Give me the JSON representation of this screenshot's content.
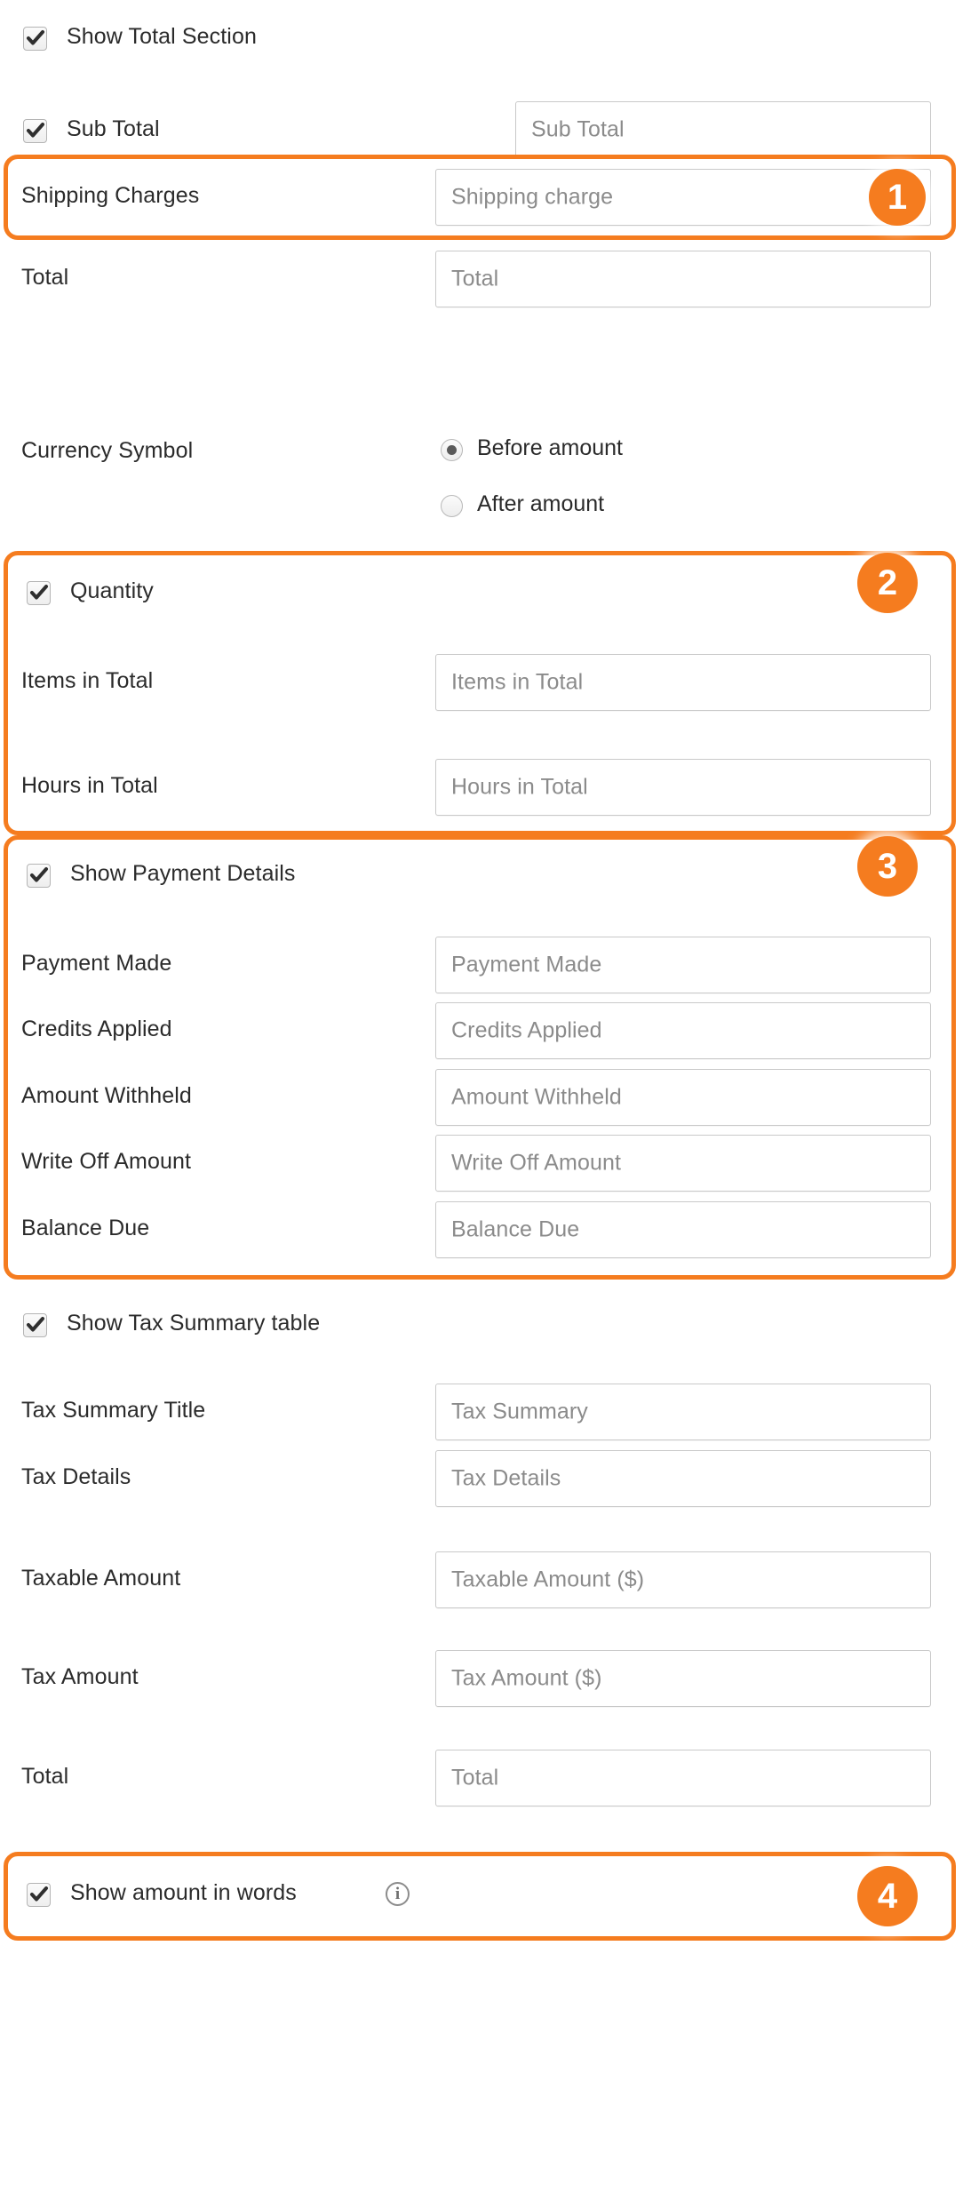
{
  "colors": {
    "accent": "#F57C1F",
    "label_text": "#2b2b2b",
    "placeholder_text": "#8b8b8b",
    "field_border": "#c9c9c9",
    "page_background": "#ffffff"
  },
  "sections": {
    "total_section": {
      "toggle_label": "Show Total Section",
      "toggle_checked": true
    },
    "sub_total": {
      "toggle_label": "Sub Total",
      "toggle_checked": true,
      "field_placeholder": "Sub Total"
    },
    "shipping_charges": {
      "label": "Shipping Charges",
      "field_placeholder": "Shipping charge"
    },
    "total": {
      "label": "Total",
      "field_placeholder": "Total"
    },
    "currency_symbol": {
      "label": "Currency Symbol",
      "options": [
        {
          "label": "Before amount",
          "selected": true
        },
        {
          "label": "After amount",
          "selected": false
        }
      ]
    },
    "quantity": {
      "toggle_label": "Quantity",
      "toggle_checked": true,
      "rows": [
        {
          "label": "Items in Total",
          "placeholder": "Items in Total"
        },
        {
          "label": "Hours in Total",
          "placeholder": "Hours in Total"
        }
      ]
    },
    "payment_details": {
      "toggle_label": "Show Payment Details",
      "toggle_checked": true,
      "rows": [
        {
          "label": "Payment Made",
          "placeholder": "Payment Made"
        },
        {
          "label": "Credits Applied",
          "placeholder": "Credits Applied"
        },
        {
          "label": "Amount Withheld",
          "placeholder": "Amount Withheld"
        },
        {
          "label": "Write Off Amount",
          "placeholder": "Write Off Amount"
        },
        {
          "label": "Balance Due",
          "placeholder": "Balance Due"
        }
      ]
    },
    "tax_summary": {
      "toggle_label": "Show Tax Summary table",
      "toggle_checked": true,
      "rows": [
        {
          "label": "Tax Summary Title",
          "placeholder": "Tax Summary"
        },
        {
          "label": "Tax Details",
          "placeholder": "Tax Details"
        },
        {
          "label": "Taxable Amount",
          "placeholder": "Taxable Amount ($)"
        },
        {
          "label": "Tax Amount",
          "placeholder": "Tax Amount ($)"
        },
        {
          "label": "Total",
          "placeholder": "Total"
        }
      ]
    },
    "amount_in_words": {
      "toggle_label": "Show amount in words",
      "toggle_checked": true,
      "info_icon": "info-icon",
      "info_glyph": "i"
    }
  },
  "annotations": {
    "badges": [
      {
        "number": "1"
      },
      {
        "number": "2"
      },
      {
        "number": "3"
      },
      {
        "number": "4"
      }
    ]
  }
}
